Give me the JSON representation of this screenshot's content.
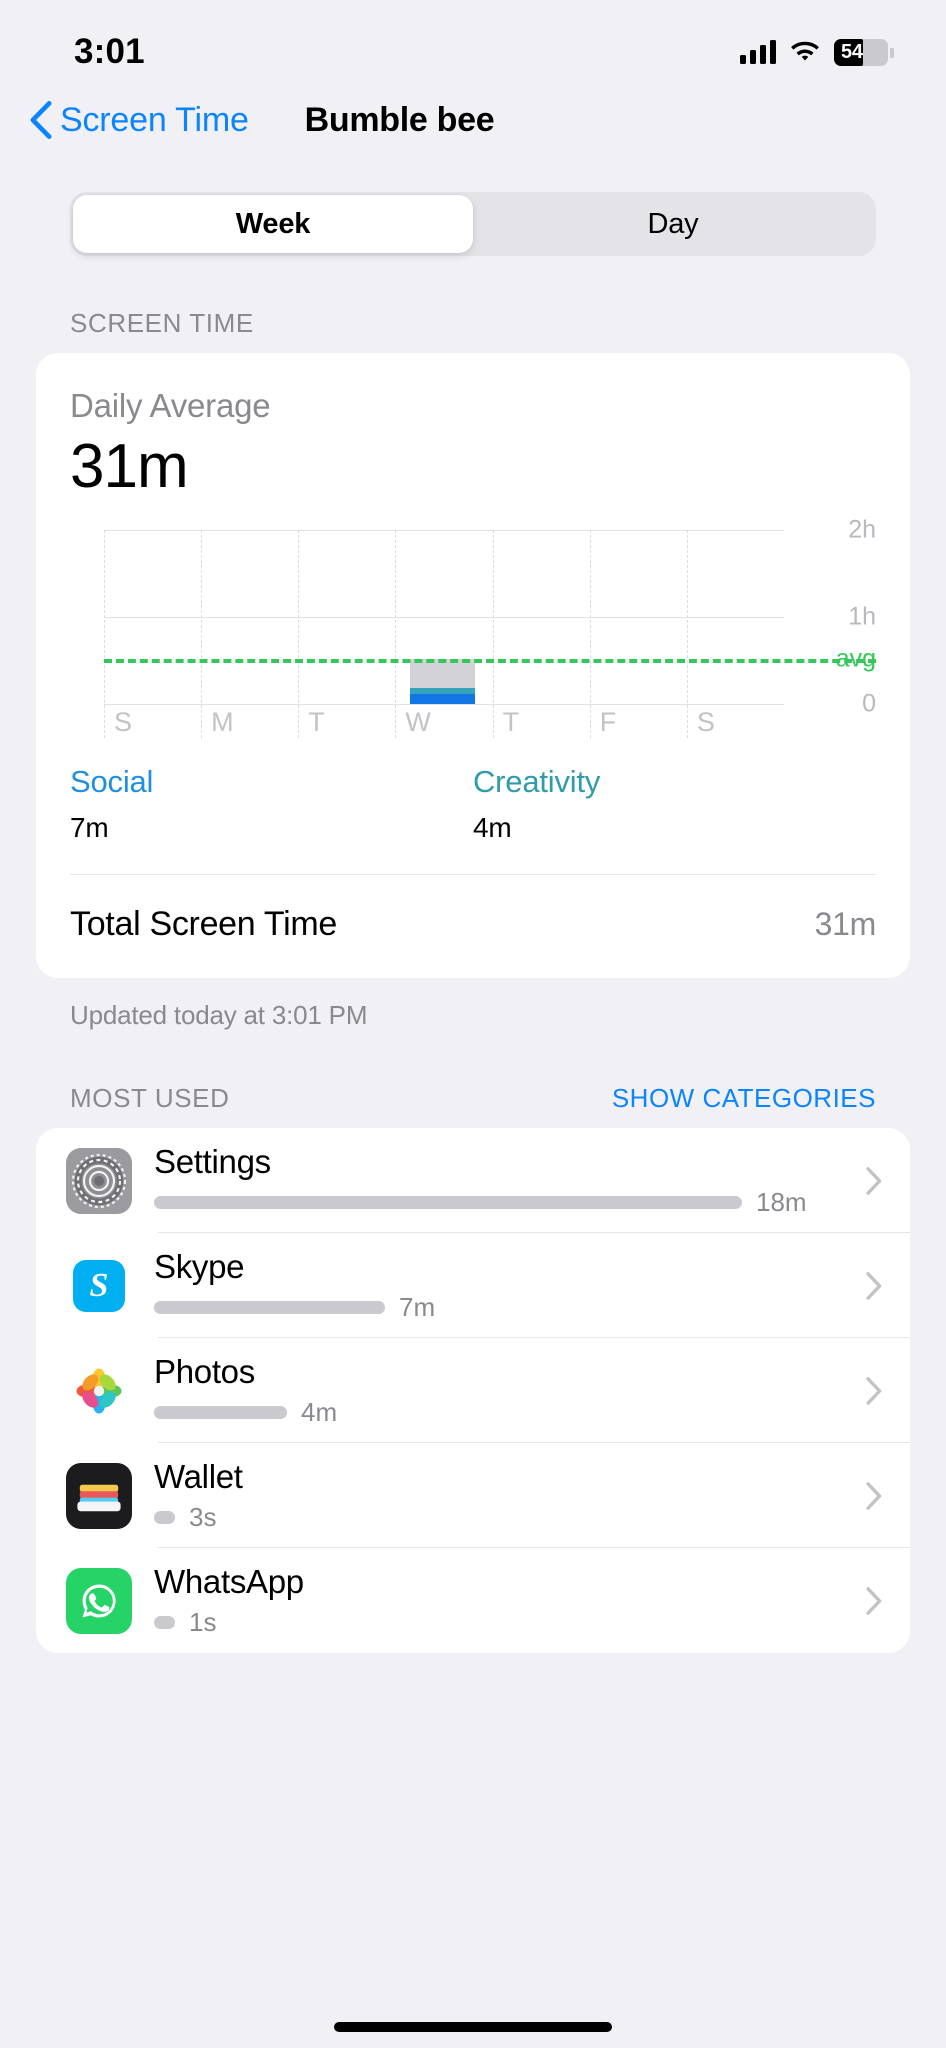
{
  "status_bar": {
    "time": "3:01",
    "battery_percent": "54",
    "icons": [
      "cellular-signal-icon",
      "wifi-icon",
      "battery-icon"
    ]
  },
  "nav": {
    "back_label": "Screen Time",
    "title": "Bumble bee"
  },
  "segmented": {
    "options": [
      {
        "label": "Week",
        "selected": true
      },
      {
        "label": "Day",
        "selected": false
      }
    ]
  },
  "screen_time_section": {
    "header": "SCREEN TIME",
    "daily_average_label": "Daily Average",
    "daily_average_value": "31m",
    "total_label": "Total Screen Time",
    "total_value": "31m",
    "updated": "Updated today at 3:01 PM",
    "legend": [
      {
        "name": "Social",
        "value": "7m",
        "color": "#1f8fe0"
      },
      {
        "name": "Creativity",
        "value": "4m",
        "color": "#2f9bab"
      }
    ]
  },
  "chart_data": {
    "type": "bar",
    "title": "Daily Average",
    "subtitle": "31m",
    "categories": [
      "S",
      "M",
      "T",
      "W",
      "T",
      "F",
      "S"
    ],
    "series": [
      {
        "name": "Social",
        "color": "#1175e3",
        "values": [
          0,
          0,
          0,
          7,
          0,
          0,
          0
        ]
      },
      {
        "name": "Creativity",
        "color": "#34a3bb",
        "values": [
          0,
          0,
          0,
          4,
          0,
          0,
          0
        ]
      },
      {
        "name": "Other",
        "color": "#d2d2d7",
        "values": [
          0,
          0,
          0,
          20,
          0,
          0,
          0
        ]
      }
    ],
    "stacked": true,
    "unit": "minutes",
    "ylim": [
      0,
      120
    ],
    "ytick_labels": [
      "2h",
      "1h",
      "0"
    ],
    "ytick_values": [
      120,
      60,
      0
    ],
    "average_line": {
      "label": "avg",
      "value": 31,
      "color": "#34c759",
      "style": "dashed"
    },
    "grid": true,
    "xlabel": "",
    "ylabel": ""
  },
  "most_used": {
    "header": "MOST USED",
    "action": "SHOW CATEGORIES",
    "apps": [
      {
        "name": "Settings",
        "time": "18m",
        "bar_percent": 84,
        "icon": "settings-icon"
      },
      {
        "name": "Skype",
        "time": "7m",
        "bar_percent": 33,
        "icon": "skype-icon"
      },
      {
        "name": "Photos",
        "time": "4m",
        "bar_percent": 19,
        "icon": "photos-icon"
      },
      {
        "name": "Wallet",
        "time": "3s",
        "bar_percent": 3,
        "icon": "wallet-icon"
      },
      {
        "name": "WhatsApp",
        "time": "1s",
        "bar_percent": 3,
        "icon": "whatsapp-icon"
      }
    ]
  }
}
